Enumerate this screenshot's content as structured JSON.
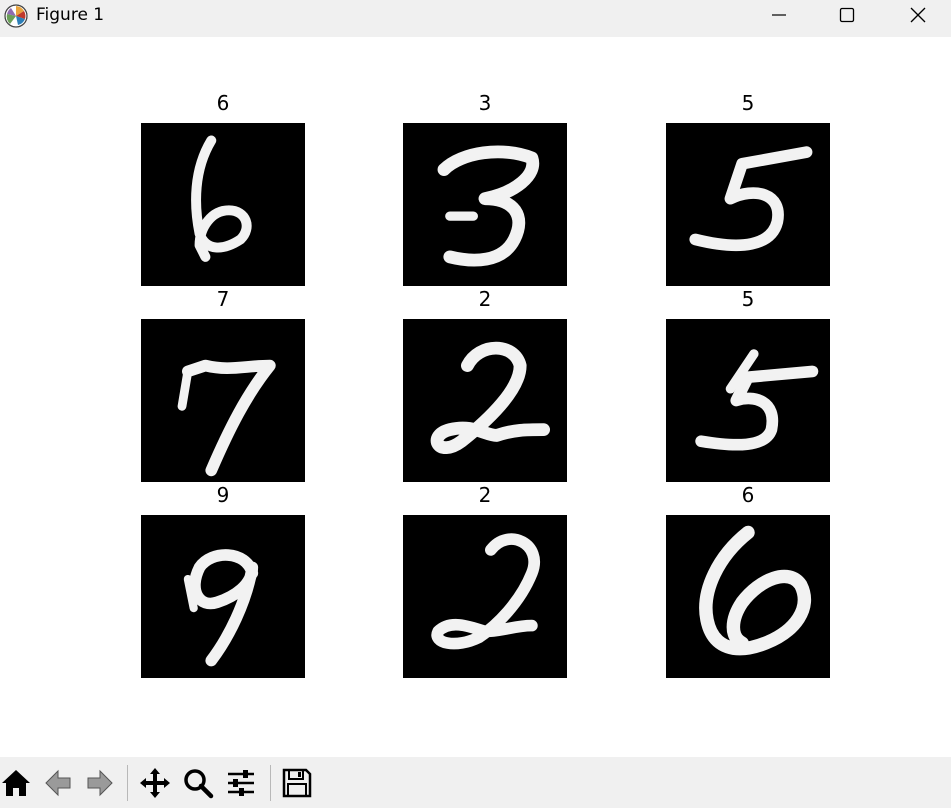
{
  "window": {
    "title": "Figure 1",
    "minimize_icon": "minimize-icon",
    "maximize_icon": "maximize-icon",
    "close_icon": "close-icon"
  },
  "figure": {
    "subplots": [
      {
        "title": "6",
        "image": "handwritten digit 6"
      },
      {
        "title": "3",
        "image": "handwritten digit 3"
      },
      {
        "title": "5",
        "image": "handwritten digit 5"
      },
      {
        "title": "7",
        "image": "handwritten digit 7"
      },
      {
        "title": "2",
        "image": "handwritten digit 2"
      },
      {
        "title": "5",
        "image": "handwritten digit 5"
      },
      {
        "title": "9",
        "image": "handwritten digit 9"
      },
      {
        "title": "2",
        "image": "handwritten digit 2"
      },
      {
        "title": "6",
        "image": "handwritten digit 6"
      }
    ],
    "image_background": "#000000",
    "stroke_color": "#f2f2f2"
  },
  "toolbar": {
    "buttons": [
      "home-icon",
      "back-icon",
      "forward-icon",
      "pan-icon",
      "zoom-icon",
      "configure-subplots-icon",
      "save-icon"
    ]
  }
}
